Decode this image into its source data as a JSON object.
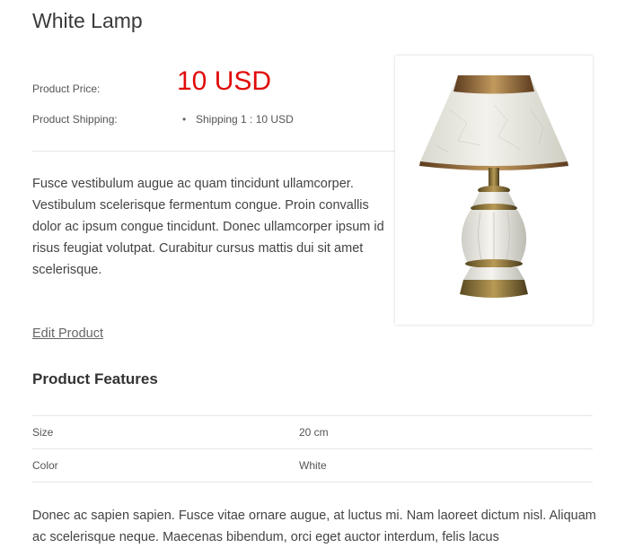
{
  "product": {
    "title": "White Lamp",
    "price_label": "Product Price:",
    "price": "10 USD",
    "shipping_label": "Product Shipping:",
    "shipping_options": [
      "Shipping 1 : 10 USD"
    ],
    "description": "Fusce vestibulum augue ac quam tincidunt ullamcorper. Vestibulum scelerisque fermentum congue. Proin convallis dolor ac ipsum congue tincidunt. Donec ullamcorper ipsum id risus feugiat volutpat. Curabitur cursus mattis dui sit amet scelerisque.",
    "edit_link": "Edit Product",
    "image_icon": "lamp-image"
  },
  "features": {
    "title": "Product Features",
    "rows": [
      {
        "name": "Size",
        "value": "20 cm"
      },
      {
        "name": "Color",
        "value": "White"
      }
    ]
  },
  "bottom_text": "Donec ac sapien sapien. Fusce vitae ornare augue, at luctus mi. Nam laoreet dictum nisl. Aliquam ac scelerisque neque. Maecenas bibendum, orci eget auctor interdum, felis lacus",
  "colors": {
    "price": "#e10b0b",
    "text": "#444444",
    "divider": "#e6e6e6"
  }
}
